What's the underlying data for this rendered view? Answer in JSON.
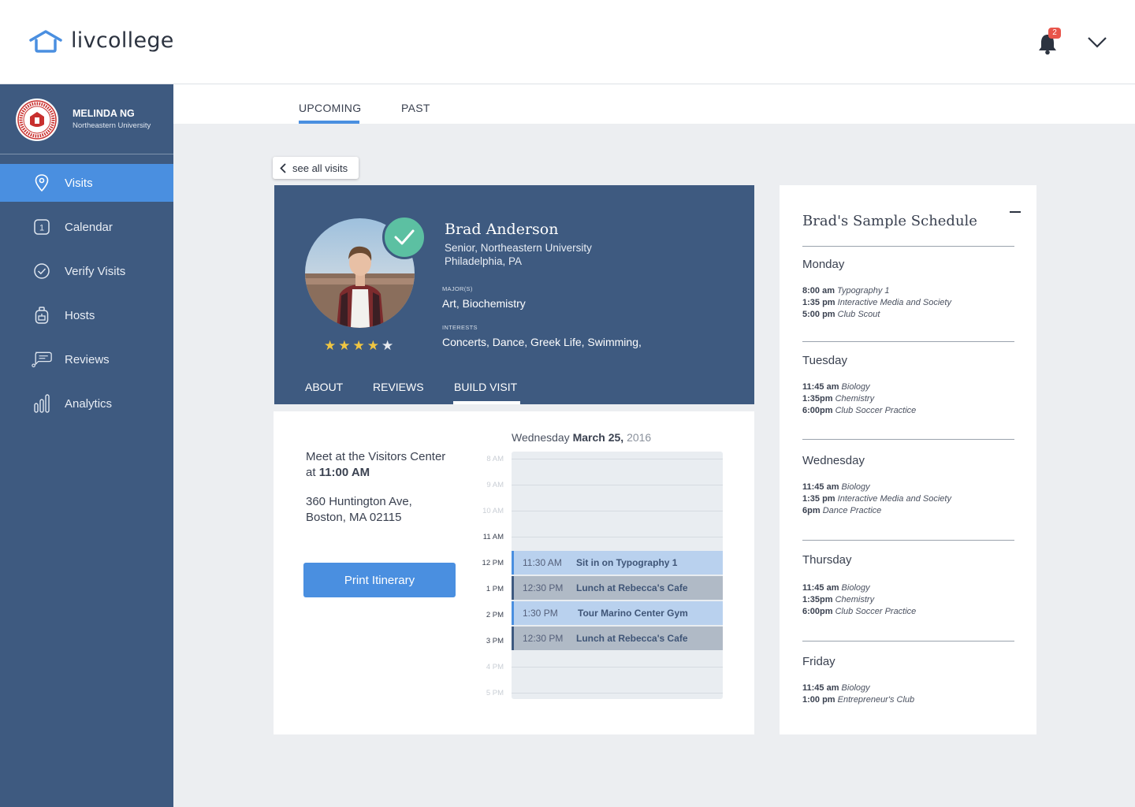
{
  "app": {
    "logo_text": "livcollege",
    "notification_count": "2"
  },
  "user": {
    "name": "MELINDA NG",
    "school": "Northeastern University"
  },
  "sidebar": {
    "items": [
      {
        "label": "Visits",
        "icon": "map-pin-icon",
        "active": true
      },
      {
        "label": "Calendar",
        "icon": "calendar-icon",
        "active": false
      },
      {
        "label": "Verify Visits",
        "icon": "check-circle-icon",
        "active": false
      },
      {
        "label": "Hosts",
        "icon": "backpack-icon",
        "active": false
      },
      {
        "label": "Reviews",
        "icon": "chat-icon",
        "active": false
      },
      {
        "label": "Analytics",
        "icon": "bar-chart-icon",
        "active": false
      }
    ]
  },
  "tabs": {
    "upcoming": "UPCOMING",
    "past": "PAST"
  },
  "back_label": "see all visits",
  "host": {
    "name": "Brad Anderson",
    "year_school": "Senior, Northeastern University",
    "location": "Philadelphia, PA",
    "majors_label": "MAJOR(S)",
    "majors": "Art, Biochemistry",
    "interests_label": "INTERESTS",
    "interests": "Concerts, Dance, Greek Life, Swimming,",
    "rating": 4,
    "rating_max": 5,
    "tabs": [
      "ABOUT",
      "REVIEWS",
      "BUILD VISIT"
    ],
    "active_tab": "BUILD VISIT"
  },
  "visit": {
    "meet_line1": "Meet at the Visitors Center",
    "meet_at": "at",
    "meet_time": "11:00 AM",
    "address_line1": "360 Huntington Ave,",
    "address_line2": "Boston, MA 02115",
    "print_button": "Print Itinerary",
    "day_weekday": "Wednesday",
    "day_date": "March 25,",
    "day_year": "2016",
    "hours": [
      "8 AM",
      "9 AM",
      "10 AM",
      "11 AM",
      "12 PM",
      "1 PM",
      "2 PM",
      "3 PM",
      "4 PM",
      "5 PM"
    ],
    "events": [
      {
        "time": "11:30 AM",
        "title": "Sit in on Typography 1",
        "style": "blue"
      },
      {
        "time": "12:30 PM",
        "title": "Lunch at Rebecca's Cafe",
        "style": "grey"
      },
      {
        "time": "1:30 PM",
        "title": "Tour Marino Center Gym",
        "style": "blue"
      },
      {
        "time": "12:30 PM",
        "title": "Lunch at Rebecca's Cafe",
        "style": "grey"
      }
    ]
  },
  "schedule": {
    "title": "Brad's Sample Schedule",
    "days": [
      {
        "day": "Monday",
        "items": [
          {
            "time": "8:00 am",
            "class": "Typography 1"
          },
          {
            "time": "1:35 pm",
            "class": "Interactive Media and Society"
          },
          {
            "time": "5:00 pm",
            "class": "Club Scout"
          }
        ]
      },
      {
        "day": "Tuesday",
        "items": [
          {
            "time": "11:45 am",
            "class": "Biology"
          },
          {
            "time": "1:35pm",
            "class": "Chemistry"
          },
          {
            "time": "6:00pm",
            "class": "Club Soccer Practice"
          }
        ]
      },
      {
        "day": "Wednesday",
        "items": [
          {
            "time": "11:45 am",
            "class": "Biology"
          },
          {
            "time": "1:35 pm",
            "class": "Interactive Media and Society"
          },
          {
            "time": "6pm",
            "class": "Dance Practice"
          }
        ]
      },
      {
        "day": "Thursday",
        "items": [
          {
            "time": "11:45 am",
            "class": "Biology"
          },
          {
            "time": "1:35pm",
            "class": "Chemistry"
          },
          {
            "time": "6:00pm",
            "class": "Club Soccer Practice"
          }
        ]
      },
      {
        "day": "Friday",
        "items": [
          {
            "time": "11:45 am",
            "class": "Biology"
          },
          {
            "time": "1:00 pm",
            "class": "Entrepreneur's Club"
          }
        ]
      }
    ]
  },
  "colors": {
    "sidebar": "#3e5a80",
    "accent": "#4a8fe0",
    "verified": "#5cc0a2",
    "star": "#f0c642",
    "badge": "#e8554b"
  }
}
